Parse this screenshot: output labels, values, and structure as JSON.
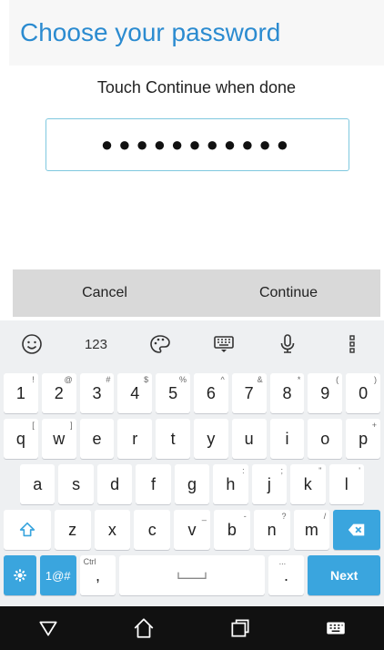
{
  "dialog": {
    "title": "Choose your password",
    "subtitle": "Touch Continue when done",
    "password_mask": "●●●●●●●●●●●",
    "cancel_label": "Cancel",
    "continue_label": "Continue"
  },
  "keyboard": {
    "toolbar": [
      {
        "name": "emoji-icon",
        "label": ""
      },
      {
        "name": "numbers-toggle",
        "label": "123"
      },
      {
        "name": "theme-icon",
        "label": ""
      },
      {
        "name": "keyboard-icon",
        "label": ""
      },
      {
        "name": "microphone-icon",
        "label": ""
      },
      {
        "name": "more-icon",
        "label": ""
      }
    ],
    "row1": [
      {
        "k": "1",
        "a": "!"
      },
      {
        "k": "2",
        "a": "@"
      },
      {
        "k": "3",
        "a": "#"
      },
      {
        "k": "4",
        "a": "$"
      },
      {
        "k": "5",
        "a": "%"
      },
      {
        "k": "6",
        "a": "^"
      },
      {
        "k": "7",
        "a": "&"
      },
      {
        "k": "8",
        "a": "*"
      },
      {
        "k": "9",
        "a": "("
      },
      {
        "k": "0",
        "a": ")"
      }
    ],
    "row2": [
      {
        "k": "q",
        "a": "["
      },
      {
        "k": "w",
        "a": "]"
      },
      {
        "k": "e",
        "a": ""
      },
      {
        "k": "r",
        "a": ""
      },
      {
        "k": "t",
        "a": ""
      },
      {
        "k": "y",
        "a": ""
      },
      {
        "k": "u",
        "a": ""
      },
      {
        "k": "i",
        "a": ""
      },
      {
        "k": "o",
        "a": ""
      },
      {
        "k": "p",
        "a": "+"
      }
    ],
    "row3": [
      {
        "k": "a",
        "a": ""
      },
      {
        "k": "s",
        "a": ""
      },
      {
        "k": "d",
        "a": ""
      },
      {
        "k": "f",
        "a": ""
      },
      {
        "k": "g",
        "a": ""
      },
      {
        "k": "h",
        "a": ":"
      },
      {
        "k": "j",
        "a": ";"
      },
      {
        "k": "k",
        "a": "\""
      },
      {
        "k": "l",
        "a": "'"
      }
    ],
    "row4": [
      {
        "k": "z",
        "a": ""
      },
      {
        "k": "x",
        "a": ""
      },
      {
        "k": "c",
        "a": ""
      },
      {
        "k": "v",
        "a": "_"
      },
      {
        "k": "b",
        "a": "-"
      },
      {
        "k": "n",
        "a": "?"
      },
      {
        "k": "m",
        "a": "/"
      }
    ],
    "sym_label": "1@#",
    "comma_label": ",",
    "comma_alt": "Ctrl",
    "period_label": ".",
    "period_alt": "...",
    "next_label": "Next"
  },
  "colors": {
    "accent": "#3aa5de",
    "title": "#2b8bd0"
  }
}
